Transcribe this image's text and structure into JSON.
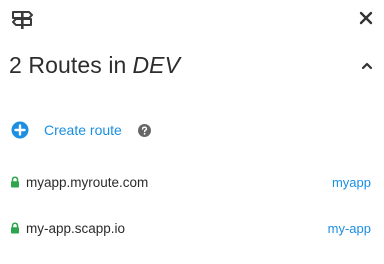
{
  "header": {
    "icon": "route-sign-icon",
    "close_icon": "close-icon"
  },
  "title": {
    "count_text": "2 Routes in",
    "env_name": "DEV",
    "collapse_icon": "chevron-up-icon"
  },
  "create": {
    "label": "Create route",
    "icon": "plus-circle-icon",
    "help_icon": "help-icon",
    "accent": "#1a8fe3"
  },
  "routes": [
    {
      "host": "myapp.myroute.com",
      "app": "myapp",
      "secure": true
    },
    {
      "host": "my-app.scapp.io",
      "app": "my-app",
      "secure": true
    }
  ],
  "colors": {
    "link": "#1a8fe3",
    "lock": "#2ea44f",
    "text": "#2b2b2b"
  }
}
